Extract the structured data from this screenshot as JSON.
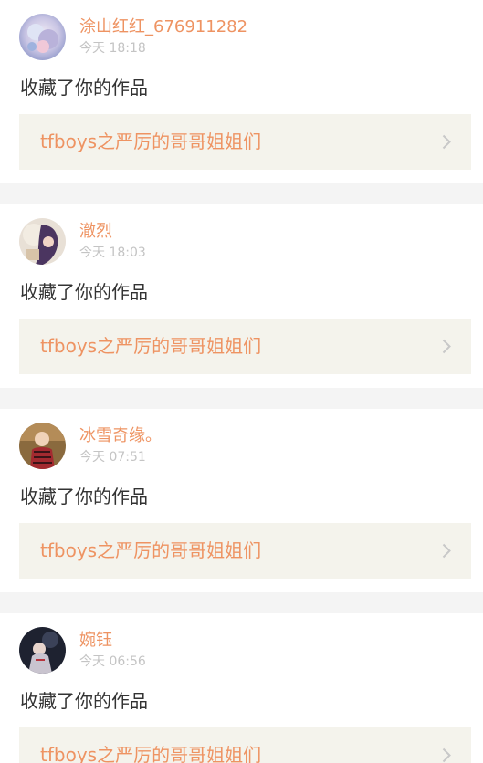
{
  "feed": {
    "items": [
      {
        "username": "涂山红红_676911282",
        "time": "今天 18:18",
        "action": "收藏了你的作品",
        "work_title": "tfboys之严厉的哥哥姐姐们"
      },
      {
        "username": "澈烈",
        "time": "今天 18:03",
        "action": "收藏了你的作品",
        "work_title": "tfboys之严厉的哥哥姐姐们"
      },
      {
        "username": "冰雪奇缘。",
        "time": "今天 07:51",
        "action": "收藏了你的作品",
        "work_title": "tfboys之严厉的哥哥姐姐们"
      },
      {
        "username": "婉钰",
        "time": "今天 06:56",
        "action": "收藏了你的作品",
        "work_title": "tfboys之严厉的哥哥姐姐们"
      }
    ]
  },
  "colors": {
    "accent": "#ee9362",
    "timestamp": "#c4c4c4",
    "text": "#333333",
    "work_bg": "#f4f3ec",
    "separator": "#f4f4f4",
    "chevron": "#c8c8c8"
  },
  "icons": {
    "chevron": "chevron-right-icon"
  }
}
